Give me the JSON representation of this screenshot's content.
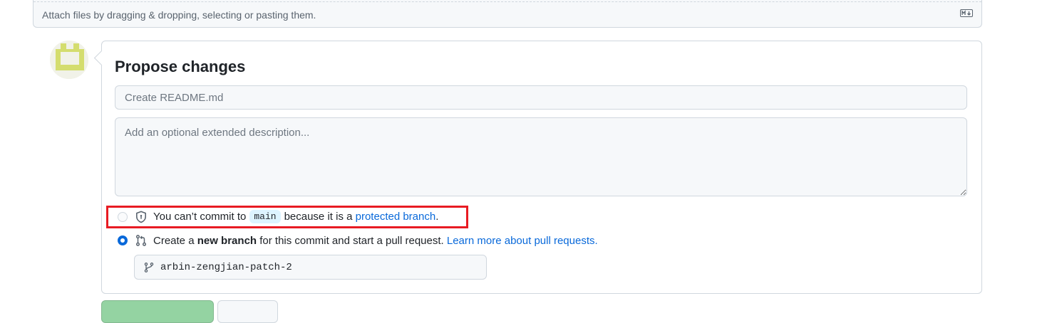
{
  "upload": {
    "hint": "Attach files by dragging & dropping, selecting or pasting them.",
    "markdown_icon": "markdown-icon"
  },
  "commit": {
    "title": "Propose changes",
    "summary_placeholder": "Create README.md",
    "description_placeholder": "Add an optional extended description...",
    "option_direct": {
      "text_before": "You can’t commit to",
      "branch": "main",
      "text_middle": "because it is a",
      "link": "protected branch",
      "text_after": ".",
      "selected": false,
      "icon": "shield-icon"
    },
    "option_new_branch": {
      "text_before": "Create a",
      "bold": "new branch",
      "text_middle": "for this commit and start a pull request.",
      "link": "Learn more about pull requests.",
      "selected": true,
      "icon": "git-pull-request-icon"
    },
    "branch_name": "arbin-zengjian-patch-2",
    "branch_icon": "git-branch-icon"
  },
  "colors": {
    "link": "#0969da",
    "highlight": "#e81b23",
    "primary_button": "#94d3a2"
  }
}
